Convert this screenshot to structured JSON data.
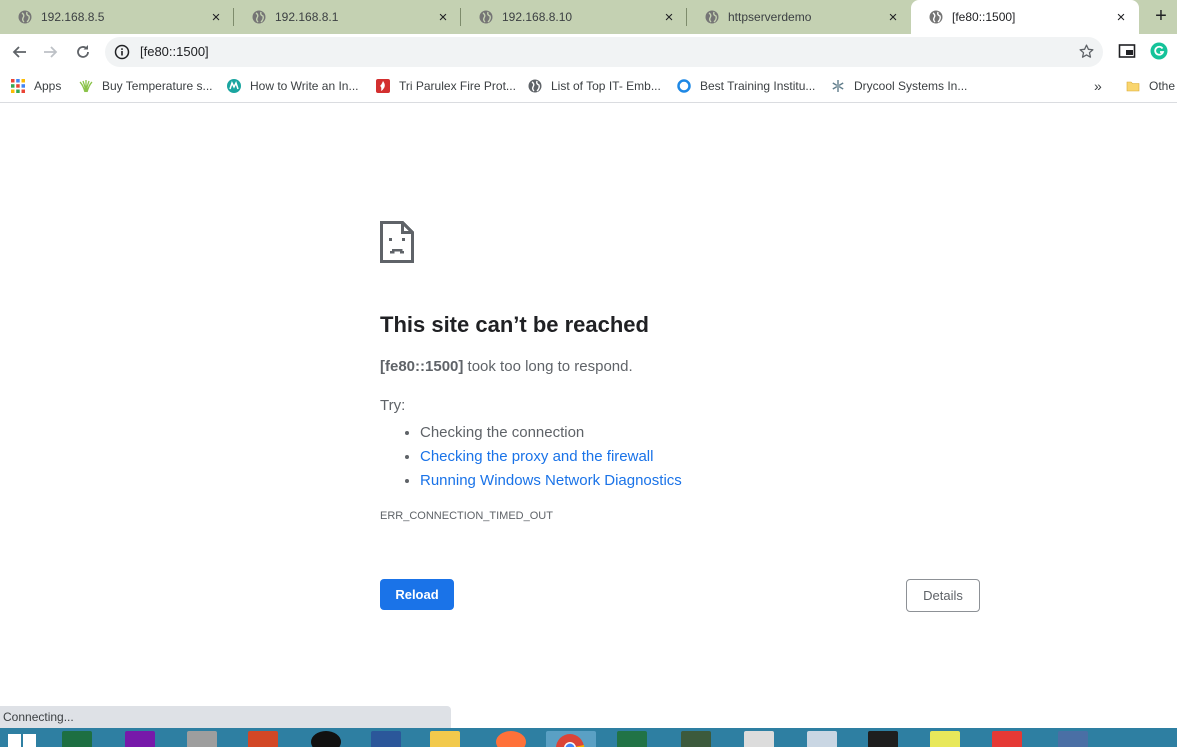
{
  "tabs": [
    {
      "title": "192.168.8.5",
      "close": "×"
    },
    {
      "title": "192.168.8.1",
      "close": "×"
    },
    {
      "title": "192.168.8.10",
      "close": "×"
    },
    {
      "title": "httpserverdemo",
      "close": "×"
    },
    {
      "title": "[fe80::1500]",
      "close": "×",
      "active": true
    }
  ],
  "new_tab_label": "+",
  "toolbar": {
    "url": "[fe80::1500]"
  },
  "bookmarks": [
    {
      "label": "Apps",
      "icon": "apps-grid-icon"
    },
    {
      "label": "Buy Temperature s...",
      "icon": "leaf-icon"
    },
    {
      "label": "How to Write an In...",
      "icon": "microchip-logo-icon"
    },
    {
      "label": "Tri Parulex Fire Prot...",
      "icon": "fire-icon"
    },
    {
      "label": "List of Top IT- Emb...",
      "icon": "globe-icon"
    },
    {
      "label": "Best Training Institu...",
      "icon": "ring-icon"
    },
    {
      "label": "Drycool Systems In...",
      "icon": "snowflake-icon"
    }
  ],
  "bookmarks_overflow": "»",
  "other_bookmarks": "Othe",
  "error": {
    "title": "This site can’t be reached",
    "host": "[fe80::1500]",
    "summary_rest": " took too long to respond.",
    "try_label": "Try:",
    "suggestions": [
      "Checking the connection",
      "Checking the proxy and the firewall",
      "Running Windows Network Diagnostics"
    ],
    "code": "ERR_CONNECTION_TIMED_OUT",
    "reload": "Reload",
    "details": "Details"
  },
  "status_text": "Connecting...",
  "colors": {
    "tabstrip": "#c4d1b2",
    "accent": "#1a73e8",
    "taskbar": "#2e7fa2"
  }
}
